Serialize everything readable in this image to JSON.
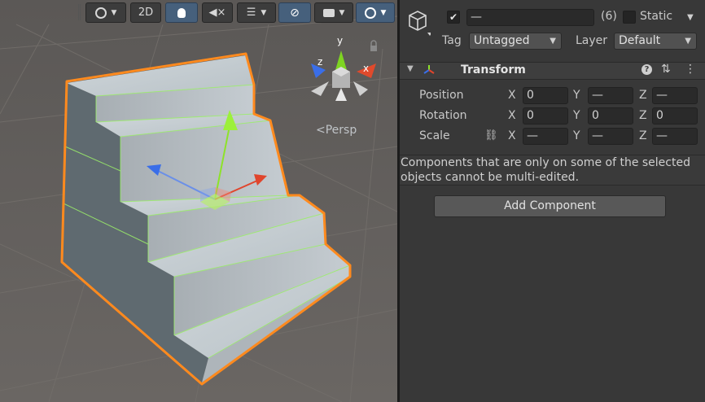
{
  "toolbar": {
    "draw_mode_icon": "shading-mode-icon",
    "two_d_label": "2D",
    "lighting_icon": "light-bulb-icon",
    "audio_icon": "audio-mute-icon",
    "effects_icon": "effects-layers-icon",
    "visibility_icon": "hidden-eye-icon",
    "camera_icon": "camera-icon",
    "gizmos_icon": "gizmos-icon"
  },
  "scene": {
    "gizmo_axes": {
      "x": "x",
      "y": "y",
      "z": "z"
    },
    "projection_label": "Persp"
  },
  "inspector": {
    "object_name_placeholder": "—",
    "object_count": "(6)",
    "static_label": "Static",
    "static_checked": false,
    "active_checked": true,
    "tag_label": "Tag",
    "tag_value": "Untagged",
    "layer_label": "Layer",
    "layer_value": "Default",
    "transform": {
      "title": "Transform",
      "position_label": "Position",
      "rotation_label": "Rotation",
      "scale_label": "Scale",
      "position": {
        "x": "0",
        "y": "—",
        "z": "—"
      },
      "rotation": {
        "x": "0",
        "y": "0",
        "z": "0"
      },
      "scale": {
        "x": "—",
        "y": "—",
        "z": "—"
      }
    },
    "axis_labels": {
      "x": "X",
      "y": "Y",
      "z": "Z"
    },
    "multi_edit_note": "Components that are only on some of the selected objects cannot be multi-edited.",
    "add_component_label": "Add Component"
  },
  "colors": {
    "selection_outline": "#ff8a1e",
    "edge_highlight": "#9cf06a",
    "x_axis": "#e0452c",
    "y_axis": "#8ee22a",
    "z_axis": "#3a6ee8",
    "active_toggle": "#46607c"
  }
}
